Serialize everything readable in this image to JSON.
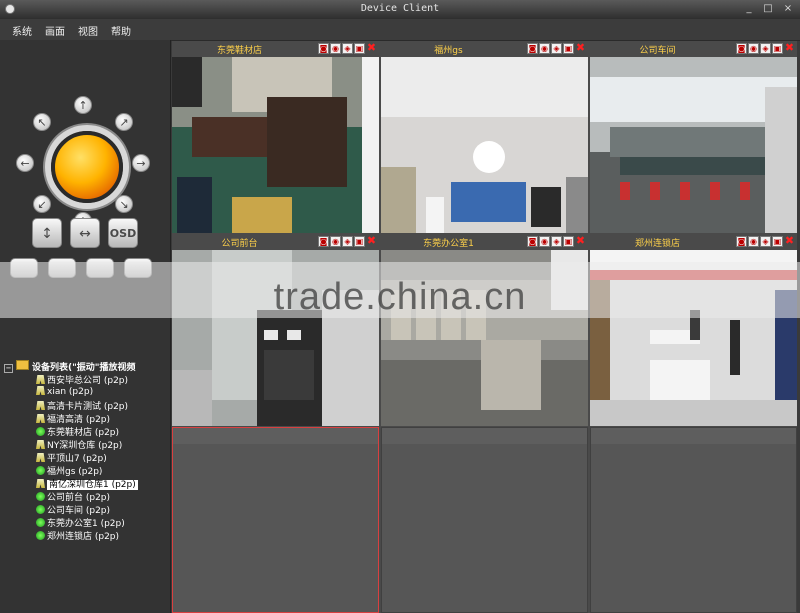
{
  "window": {
    "title": "Device Client",
    "minimize": "_",
    "maximize": "□",
    "close": "×"
  },
  "menu": [
    {
      "label": "系统"
    },
    {
      "label": "画面"
    },
    {
      "label": "视图"
    },
    {
      "label": "帮助"
    }
  ],
  "ptz": {
    "arrows": {
      "up": "↑",
      "down": "↓",
      "left": "←",
      "right": "→",
      "up_left": "↖",
      "up_right": "↗",
      "down_left": "↙",
      "down_right": "↘"
    },
    "tilt_label": "↕",
    "pan_label": "↔",
    "osd_label": "OSD"
  },
  "tree": {
    "root_label": "设备列表(\"振动\"播放视频",
    "items": [
      {
        "label": "西安毕总公司 (p2p)",
        "icon": "camera-offline-icon"
      },
      {
        "label": "xian (p2p)",
        "icon": "camera-offline-icon"
      },
      {
        "label": "高清卡片测试 (p2p)",
        "icon": "camera-offline-icon"
      },
      {
        "label": "福清高清 (p2p)",
        "icon": "camera-offline-icon"
      },
      {
        "label": "东莞鞋材店 (p2p)",
        "icon": "camera-online-icon"
      },
      {
        "label": "NY深圳仓库 (p2p)",
        "icon": "camera-offline-icon"
      },
      {
        "label": "平顶山7 (p2p)",
        "icon": "camera-offline-icon"
      },
      {
        "label": "福州gs (p2p)",
        "icon": "camera-online-icon"
      },
      {
        "label": "南亿深圳仓库1 (p2p)",
        "icon": "camera-offline-icon",
        "selected": true
      },
      {
        "label": "公司前台 (p2p)",
        "icon": "camera-online-icon"
      },
      {
        "label": "公司车间 (p2p)",
        "icon": "camera-online-icon"
      },
      {
        "label": "东莞办公室1 (p2p)",
        "icon": "camera-online-icon"
      },
      {
        "label": "郑州连锁店 (p2p)",
        "icon": "camera-online-icon"
      }
    ]
  },
  "video_cells": [
    {
      "title": "东莞鞋材店",
      "scene": "office-desk"
    },
    {
      "title": "福州gs",
      "scene": "lobby"
    },
    {
      "title": "公司车间",
      "scene": "workshop"
    },
    {
      "title": "公司前台",
      "scene": "reception"
    },
    {
      "title": "东莞办公室1",
      "scene": "storage"
    },
    {
      "title": "郑州连锁店",
      "scene": "store"
    }
  ],
  "cell_icons": [
    "record-icon",
    "snapshot-icon",
    "audio-icon",
    "camera-icon",
    "close-icon"
  ],
  "cell_icon_glyphs": {
    "close": "✖"
  },
  "watermark": {
    "text": "trade.china.cn"
  }
}
